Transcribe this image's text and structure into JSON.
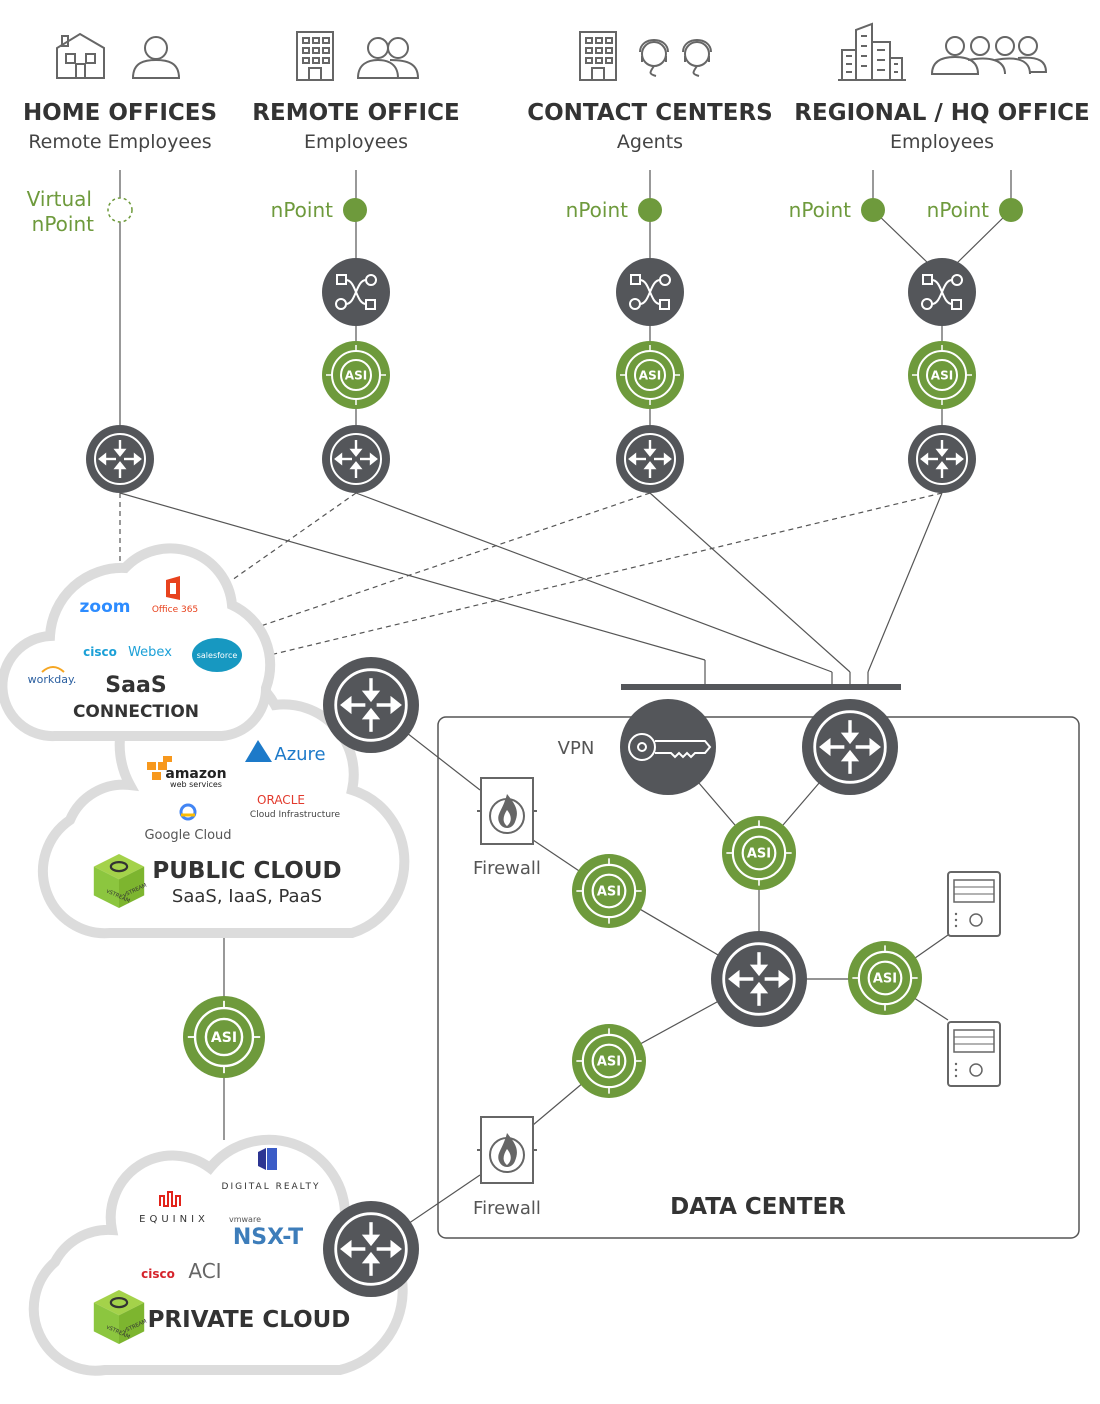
{
  "colors": {
    "node_dark": "#54565a",
    "node_green": "#6e9a3c",
    "cloud_outline": "#dcdcdc",
    "text_green": "#6e9a3c"
  },
  "sites": [
    {
      "title": "HOME OFFICES",
      "subtitle": "Remote Employees",
      "icons": [
        "house-icon",
        "person-icon"
      ],
      "npoint": "Virtual nPoint"
    },
    {
      "title": "REMOTE OFFICE",
      "subtitle": "Employees",
      "icons": [
        "building-icon",
        "people-icon"
      ],
      "npoint": "nPoint"
    },
    {
      "title": "CONTACT CENTERS",
      "subtitle": "Agents",
      "icons": [
        "building-icon",
        "headset-agent-icon"
      ],
      "npoint": "nPoint"
    },
    {
      "title": "REGIONAL / HQ OFFICE",
      "subtitle": "Employees",
      "icons": [
        "city-icon",
        "group-icon"
      ],
      "npoint": "nPoint",
      "npoint2": "nPoint"
    }
  ],
  "virtual_npoint": {
    "line1": "Virtual",
    "line2": "nPoint"
  },
  "asi_label": "ASI",
  "saas": {
    "title1": "SaaS",
    "title2": "CONNECTION",
    "logos": [
      "zoom",
      "Office 365",
      "cisco",
      "Webex",
      "salesforce",
      "workday."
    ]
  },
  "public_cloud": {
    "title": "PUBLIC CLOUD",
    "subtitle": "SaaS, IaaS, PaaS",
    "logos": [
      "amazon",
      "web services",
      "Azure",
      "ORACLE",
      "Cloud Infrastructure",
      "Google Cloud"
    ],
    "cube": "vSTREAM"
  },
  "private_cloud": {
    "title": "PRIVATE CLOUD",
    "logos": [
      "DIGITAL REALTY",
      "EQUINIX",
      "vmware",
      "NSX-T",
      "cisco",
      "ACI"
    ],
    "cube": "vSTREAM"
  },
  "data_center": {
    "title": "DATA CENTER",
    "vpn": "VPN",
    "firewall": "Firewall"
  }
}
